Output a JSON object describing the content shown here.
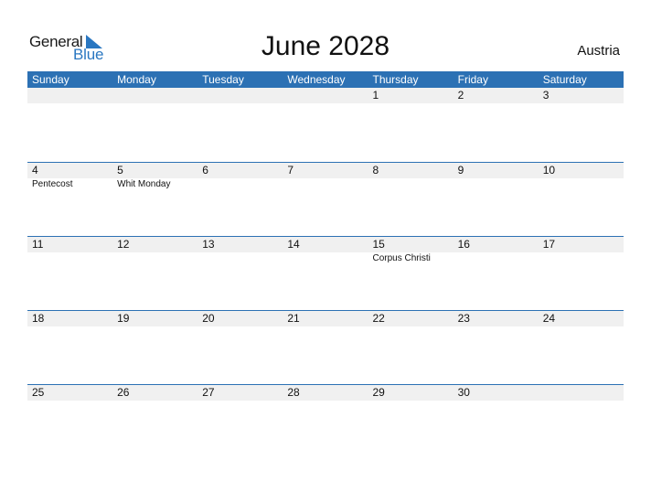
{
  "logo": {
    "word1": "General",
    "word2": "Blue"
  },
  "title": "June 2028",
  "country": "Austria",
  "colors": {
    "accent": "#2c71b4",
    "band": "#f0f0f0",
    "logo_blue": "#2a77c1"
  },
  "weekdays": [
    "Sunday",
    "Monday",
    "Tuesday",
    "Wednesday",
    "Thursday",
    "Friday",
    "Saturday"
  ],
  "weeks": [
    {
      "days": [
        "",
        "",
        "",
        "",
        "1",
        "2",
        "3"
      ],
      "events": [
        "",
        "",
        "",
        "",
        "",
        "",
        ""
      ]
    },
    {
      "days": [
        "4",
        "5",
        "6",
        "7",
        "8",
        "9",
        "10"
      ],
      "events": [
        "Pentecost",
        "Whit Monday",
        "",
        "",
        "",
        "",
        ""
      ]
    },
    {
      "days": [
        "11",
        "12",
        "13",
        "14",
        "15",
        "16",
        "17"
      ],
      "events": [
        "",
        "",
        "",
        "",
        "Corpus Christi",
        "",
        ""
      ]
    },
    {
      "days": [
        "18",
        "19",
        "20",
        "21",
        "22",
        "23",
        "24"
      ],
      "events": [
        "",
        "",
        "",
        "",
        "",
        "",
        ""
      ]
    },
    {
      "days": [
        "25",
        "26",
        "27",
        "28",
        "29",
        "30",
        ""
      ],
      "events": [
        "",
        "",
        "",
        "",
        "",
        "",
        ""
      ]
    }
  ]
}
